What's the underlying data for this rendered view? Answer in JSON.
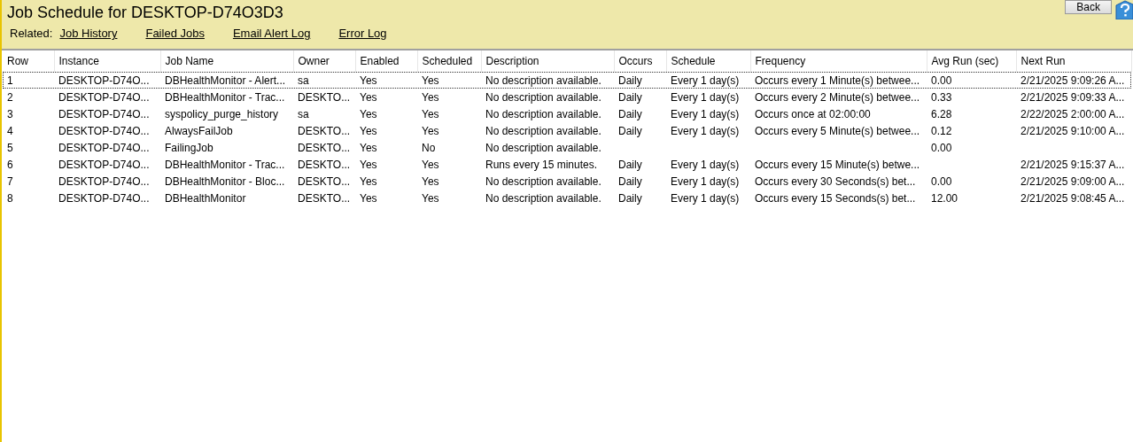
{
  "header": {
    "title": "Job Schedule for DESKTOP-D74O3D3",
    "back_button": "Back",
    "related_label": "Related:",
    "related_links": [
      "Job History",
      "Failed Jobs",
      "Email Alert Log",
      "Error Log"
    ]
  },
  "table": {
    "columns": [
      "Row",
      "Instance",
      "Job Name",
      "Owner",
      "Enabled",
      "Scheduled",
      "Description",
      "Occurs",
      "Schedule",
      "Frequency",
      "Avg Run (sec)",
      "Next Run"
    ],
    "rows": [
      {
        "focused": true,
        "cells": [
          "1",
          "DESKTOP-D74O...",
          "DBHealthMonitor - Alert...",
          "sa",
          "Yes",
          "Yes",
          "No description available.",
          "Daily",
          "Every 1 day(s)",
          "Occurs every 1 Minute(s) betwee...",
          "0.00",
          "2/21/2025 9:09:26 A..."
        ]
      },
      {
        "focused": false,
        "cells": [
          "2",
          "DESKTOP-D74O...",
          "DBHealthMonitor - Trac...",
          "DESKTO...",
          "Yes",
          "Yes",
          "No description available.",
          "Daily",
          "Every 1 day(s)",
          "Occurs every 2 Minute(s) betwee...",
          "0.33",
          "2/21/2025 9:09:33 A..."
        ]
      },
      {
        "focused": false,
        "cells": [
          "3",
          "DESKTOP-D74O...",
          "syspolicy_purge_history",
          "sa",
          "Yes",
          "Yes",
          "No description available.",
          "Daily",
          "Every 1 day(s)",
          "Occurs once at 02:00:00",
          "6.28",
          "2/22/2025 2:00:00 A..."
        ]
      },
      {
        "focused": false,
        "cells": [
          "4",
          "DESKTOP-D74O...",
          "AlwaysFailJob",
          "DESKTO...",
          "Yes",
          "Yes",
          "No description available.",
          "Daily",
          "Every 1 day(s)",
          "Occurs every 5 Minute(s) betwee...",
          "0.12",
          "2/21/2025 9:10:00 A..."
        ]
      },
      {
        "focused": false,
        "cells": [
          "5",
          "DESKTOP-D74O...",
          "FailingJob",
          "DESKTO...",
          "Yes",
          "No",
          "No description available.",
          "",
          "",
          "",
          "0.00",
          ""
        ]
      },
      {
        "focused": false,
        "cells": [
          "6",
          "DESKTOP-D74O...",
          "DBHealthMonitor - Trac...",
          "DESKTO...",
          "Yes",
          "Yes",
          "Runs every 15 minutes.",
          "Daily",
          "Every 1 day(s)",
          "Occurs every 15 Minute(s) betwe...",
          "",
          "2/21/2025 9:15:37 A..."
        ]
      },
      {
        "focused": false,
        "cells": [
          "7",
          "DESKTOP-D74O...",
          "DBHealthMonitor - Bloc...",
          "DESKTO...",
          "Yes",
          "Yes",
          "No description available.",
          "Daily",
          "Every 1 day(s)",
          "Occurs every 30 Seconds(s) bet...",
          "0.00",
          "2/21/2025 9:09:00 A..."
        ]
      },
      {
        "focused": false,
        "cells": [
          "8",
          "DESKTOP-D74O...",
          "DBHealthMonitor",
          "DESKTO...",
          "Yes",
          "Yes",
          "No description available.",
          "Daily",
          "Every 1 day(s)",
          "Occurs every 15 Seconds(s) bet...",
          "12.00",
          "2/21/2025 9:08:45 A..."
        ]
      }
    ]
  }
}
